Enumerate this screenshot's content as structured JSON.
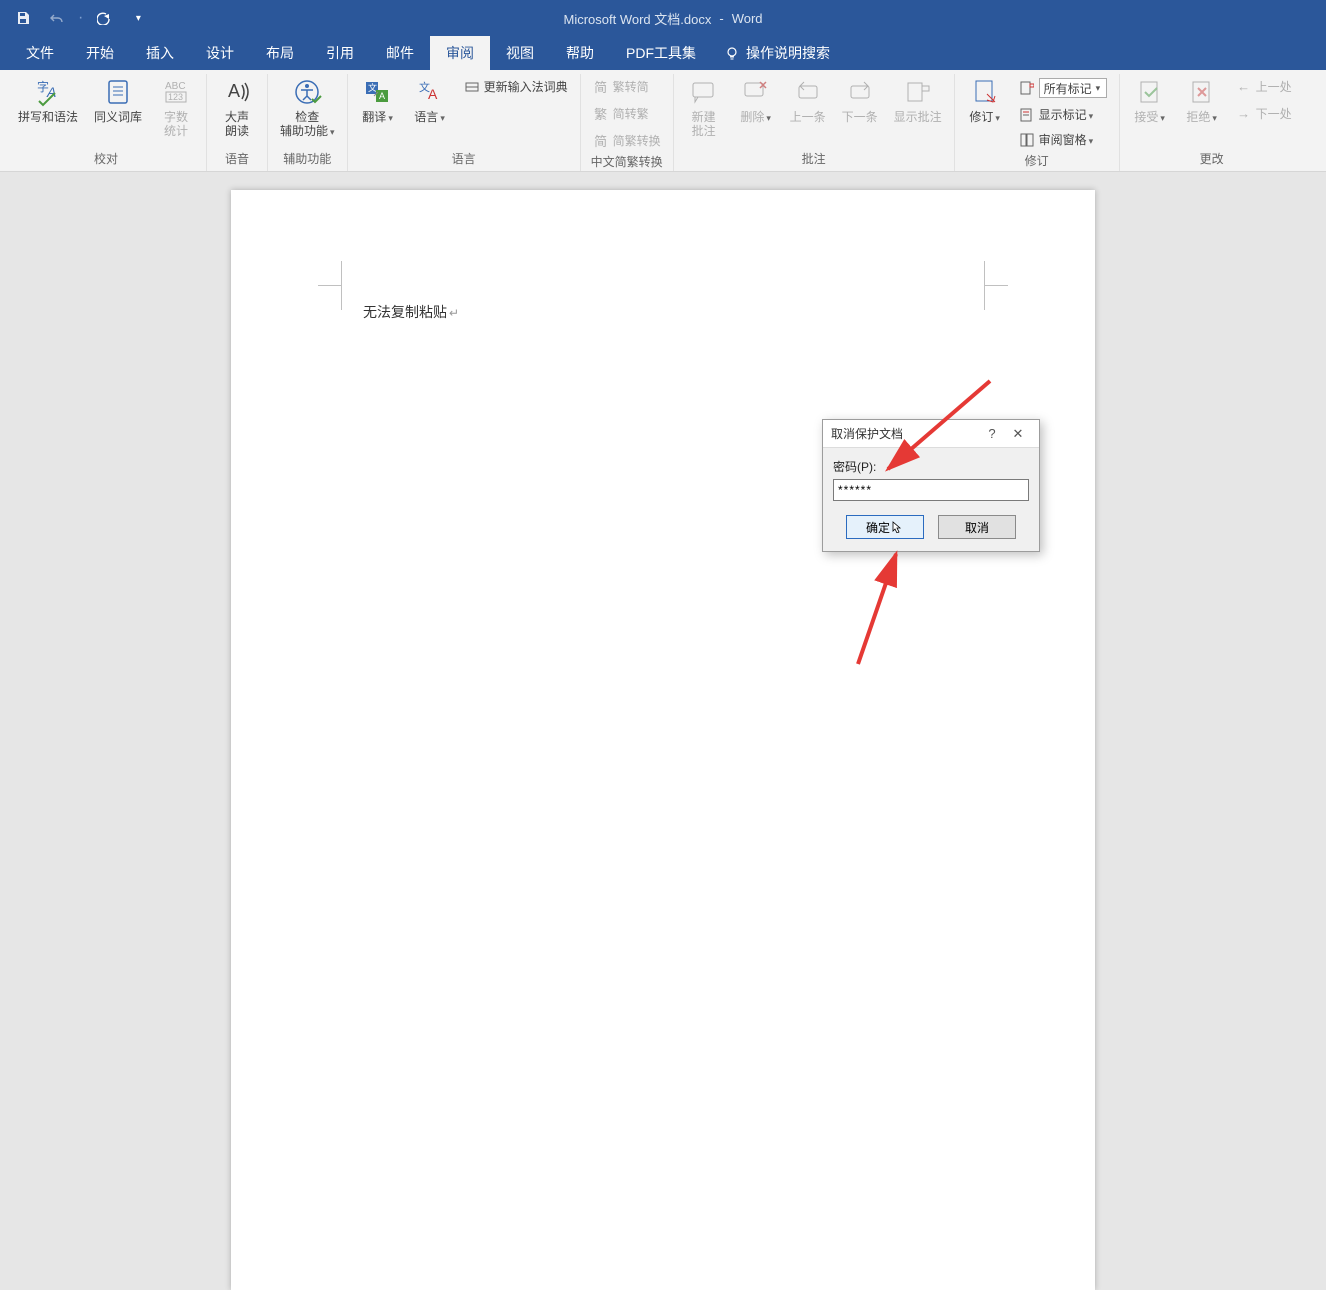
{
  "titlebar": {
    "doc_name": "Microsoft Word 文档.docx",
    "app_sep": "-",
    "app_name": "Word"
  },
  "tabs": {
    "file": "文件",
    "home": "开始",
    "insert": "插入",
    "design": "设计",
    "layout": "布局",
    "references": "引用",
    "mailings": "邮件",
    "review": "审阅",
    "view": "视图",
    "help": "帮助",
    "pdf": "PDF工具集",
    "tellme": "操作说明搜索"
  },
  "ribbon": {
    "proofing": {
      "spell": "拼写和语法",
      "thesaurus": "同义词库",
      "wordcount_l1": "字数",
      "wordcount_l2": "统计",
      "label": "校对"
    },
    "speech": {
      "readaloud_l1": "大声",
      "readaloud_l2": "朗读",
      "label": "语音"
    },
    "accessibility": {
      "check_l1": "检查",
      "check_l2": "辅助功能",
      "label": "辅助功能"
    },
    "language": {
      "translate": "翻译",
      "language": "语言",
      "ime": "更新输入法词典",
      "label": "语言"
    },
    "chinese": {
      "s2t": "繁转简",
      "t2s": "简转繁",
      "convert": "简繁转换",
      "label": "中文简繁转换"
    },
    "comments": {
      "new_l1": "新建",
      "new_l2": "批注",
      "delete": "删除",
      "prev": "上一条",
      "next": "下一条",
      "show": "显示批注",
      "label": "批注"
    },
    "tracking": {
      "track": "修订",
      "display_combo": "所有标记",
      "show_markup": "显示标记",
      "review_pane": "审阅窗格",
      "label": "修订"
    },
    "changes": {
      "accept": "接受",
      "reject": "拒绝",
      "prev": "上一处",
      "next": "下一处",
      "label": "更改"
    }
  },
  "document": {
    "body_text": "无法复制粘贴"
  },
  "dialog": {
    "title": "取消保护文档",
    "help": "?",
    "close": "✕",
    "password_label": "密码(P):",
    "password_value": "******",
    "ok": "确定",
    "cancel": "取消"
  }
}
